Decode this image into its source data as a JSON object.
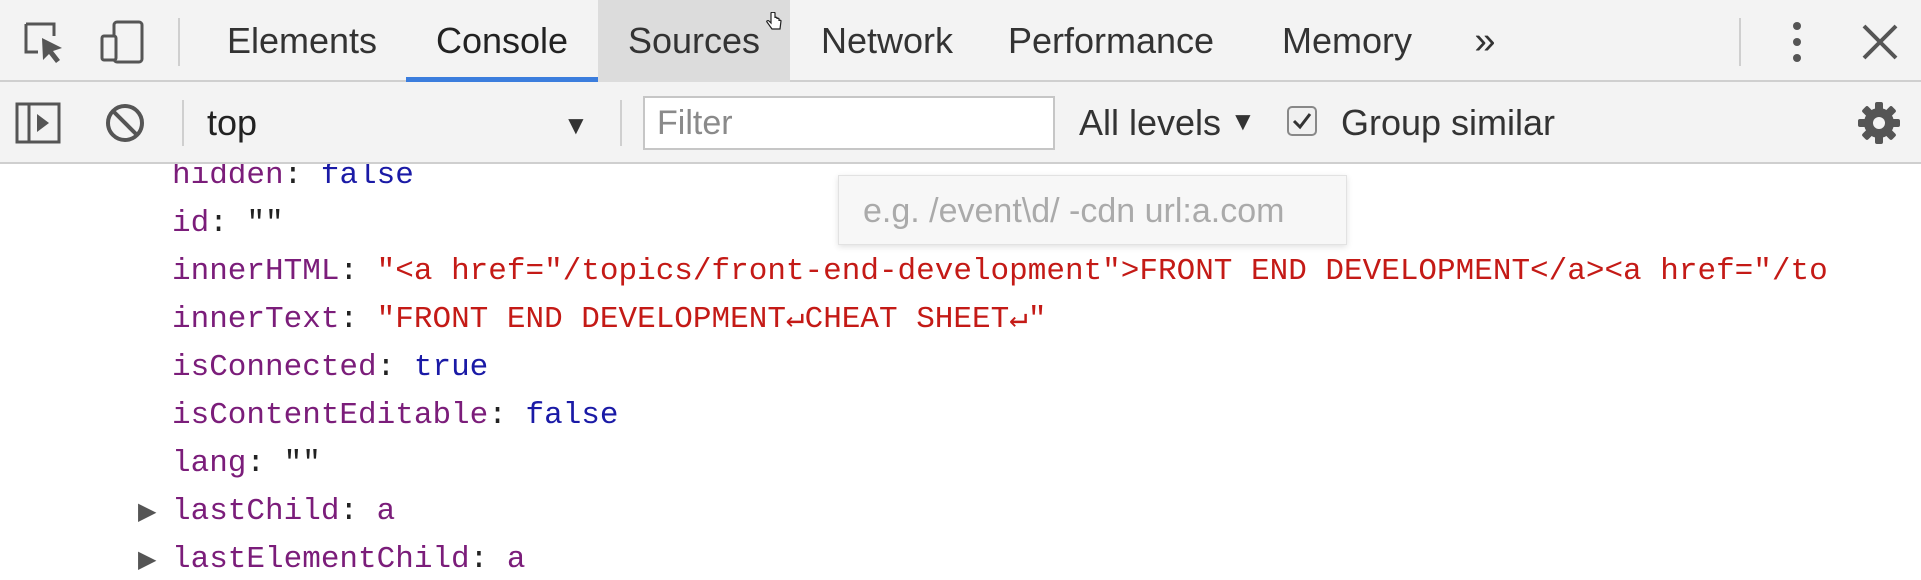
{
  "tabs": [
    {
      "label": "Elements"
    },
    {
      "label": "Console"
    },
    {
      "label": "Sources"
    },
    {
      "label": "Network"
    },
    {
      "label": "Performance"
    },
    {
      "label": "Memory"
    }
  ],
  "more_tabs_label": "»",
  "toolbar": {
    "context": "top",
    "filter_placeholder": "Filter",
    "levels": "All levels",
    "group_similar_label": "Group similar",
    "group_similar_checked": true
  },
  "tooltip": "e.g. /event\\d/ -cdn url:a.com",
  "properties": [
    {
      "key": "hidden",
      "sep": ": ",
      "value": "false",
      "vtype": "b",
      "expandable": false
    },
    {
      "key": "id",
      "sep": ": ",
      "value": "\"\"",
      "vtype": "p",
      "expandable": false
    },
    {
      "key": "innerHTML",
      "sep": ": ",
      "value": "\"<a href=\"/topics/front-end-development\">FRONT END DEVELOPMENT</a><a href=\"/to",
      "vtype": "s",
      "expandable": false
    },
    {
      "key": "innerText",
      "sep": ": ",
      "value": "\"FRONT END DEVELOPMENT↵CHEAT SHEET↵\"",
      "vtype": "s",
      "expandable": false
    },
    {
      "key": "isConnected",
      "sep": ": ",
      "value": "true",
      "vtype": "b",
      "expandable": false
    },
    {
      "key": "isContentEditable",
      "sep": ": ",
      "value": "false",
      "vtype": "b",
      "expandable": false
    },
    {
      "key": "lang",
      "sep": ": ",
      "value": "\"\"",
      "vtype": "p",
      "expandable": false
    },
    {
      "key": "lastChild",
      "sep": ": ",
      "value": "a",
      "vtype": "k",
      "expandable": true
    },
    {
      "key": "lastElementChild",
      "sep": ": ",
      "value": "a",
      "vtype": "k",
      "expandable": true
    }
  ],
  "colors": {
    "accent": "#3b7ddd",
    "property_key": "#7b1d7a",
    "string_value": "#c41a16",
    "boolean_value": "#1a1aa6"
  },
  "icons": [
    "inspect-element-icon",
    "device-toolbar-icon",
    "more-tabs-icon",
    "kebab-menu-icon",
    "close-icon",
    "sidebar-toggle-icon",
    "clear-console-icon",
    "dropdown-arrow-icon",
    "checkbox-icon",
    "settings-gear-icon",
    "expand-triangle-icon"
  ]
}
